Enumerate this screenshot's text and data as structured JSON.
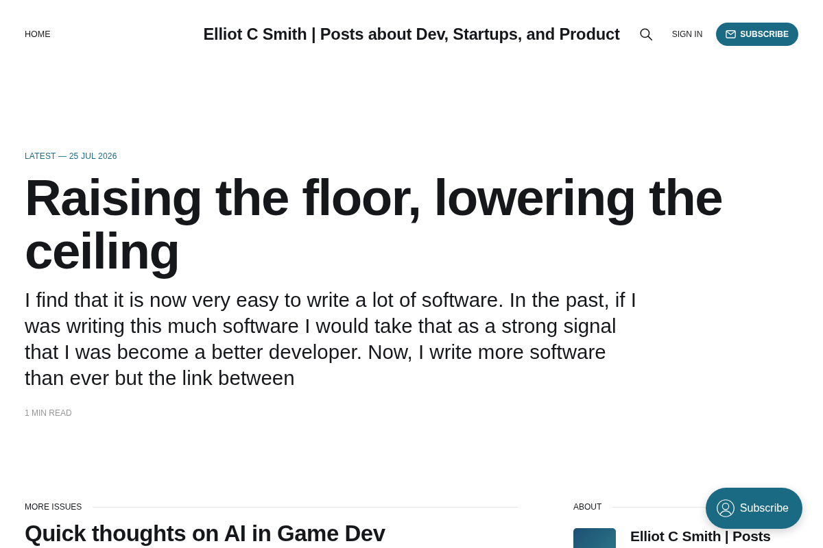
{
  "header": {
    "nav": [
      {
        "label": "HOME"
      }
    ],
    "site_title": "Elliot C Smith | Posts about Dev, Startups, and Product",
    "sign_in": "SIGN IN",
    "subscribe_button": "SUBSCRIBE"
  },
  "latest": {
    "kicker": "LATEST — 25 JUL 2026",
    "title": "Raising the floor, lowering the ceiling",
    "excerpt": "I find that it is now very easy to write a lot of software. In the past, if I was writing this much software I would take that as a strong signal that I was become a better developer. Now, I write more software than ever but the link between",
    "reading_time": "1 MIN READ"
  },
  "more_issues": {
    "heading": "MORE ISSUES",
    "posts": [
      {
        "title": "Quick thoughts on AI in Game Dev"
      }
    ]
  },
  "about": {
    "heading": "ABOUT",
    "title": "Elliot C Smith | Posts"
  },
  "portal_button": {
    "label": "Subscribe"
  }
}
